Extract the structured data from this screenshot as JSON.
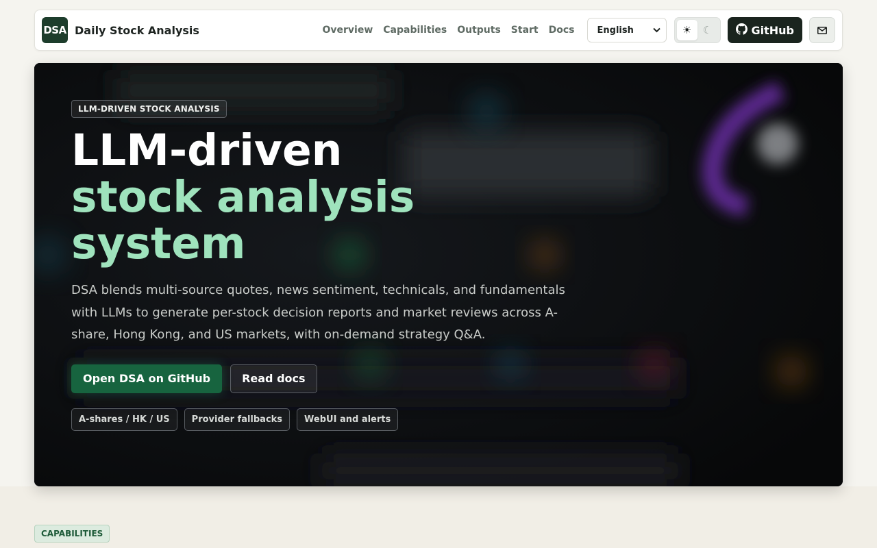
{
  "header": {
    "logo_text": "DSA",
    "brand": "Daily Stock Analysis",
    "nav": [
      {
        "label": "Overview"
      },
      {
        "label": "Capabilities"
      },
      {
        "label": "Outputs"
      },
      {
        "label": "Start"
      },
      {
        "label": "Docs"
      }
    ],
    "language_select": {
      "value": "English",
      "options": [
        "English"
      ]
    },
    "theme": {
      "light_icon": "sun-icon",
      "dark_icon": "moon-icon",
      "active": "light"
    },
    "github_label": "GitHub",
    "mail_icon": "mail-icon"
  },
  "hero": {
    "eyebrow": "LLM-DRIVEN STOCK ANALYSIS",
    "headline_line1": "LLM-driven",
    "headline_line2": "stock analysis",
    "headline_line3": "system",
    "description": "DSA blends multi-source quotes, news sentiment, technicals, and fundamentals with LLMs to generate per-stock decision reports and market reviews across A-share, Hong Kong, and US markets, with on-demand strategy Q&A.",
    "primary_cta": "Open DSA on GitHub",
    "secondary_cta": "Read docs",
    "chips": [
      "A-shares / HK / US",
      "Provider fallbacks",
      "WebUI and alerts"
    ]
  },
  "next_section": {
    "tag": "CAPABILITIES"
  },
  "colors": {
    "accent_green": "#17643f",
    "headline_mint": "#9fe3bd",
    "hero_bg": "#0b0d10",
    "logo_bg": "#1d3d2c"
  }
}
